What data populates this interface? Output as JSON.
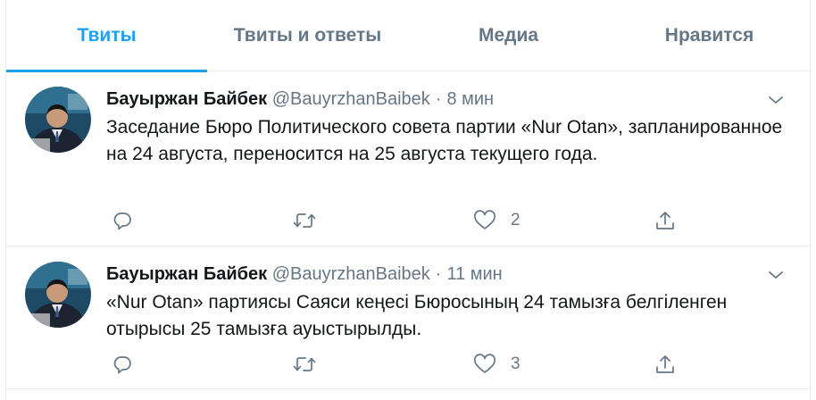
{
  "tabs": [
    {
      "label": "Твиты",
      "active": true
    },
    {
      "label": "Твиты и ответы",
      "active": false
    },
    {
      "label": "Медиа",
      "active": false
    },
    {
      "label": "Нравится",
      "active": false
    }
  ],
  "tweets": [
    {
      "name": "Бауыржан Байбек",
      "handle": "@BauyrzhanBaibek",
      "separator": "·",
      "time": "8 мин",
      "text": "Заседание Бюро Политического совета партии «Nur Otan», запланированное на 24 августа, переносится на 25 августа текущего года.",
      "likes": "2"
    },
    {
      "name": "Бауыржан Байбек",
      "handle": "@BauyrzhanBaibek",
      "separator": "·",
      "time": "11 мин",
      "text": "«Nur Otan» партиясы Саяси кеңесі Бюросының 24 тамызға белгіленген отырысы 25 тамызға ауыстырылды.",
      "likes": "3"
    }
  ],
  "icons": {
    "reply": "reply-icon",
    "retweet": "retweet-icon",
    "like": "heart-icon",
    "share": "share-icon",
    "menu": "chevron-down-icon"
  },
  "colors": {
    "accent": "#1da1f2",
    "secondary_text": "#657786",
    "divider": "#e6ecf0"
  }
}
